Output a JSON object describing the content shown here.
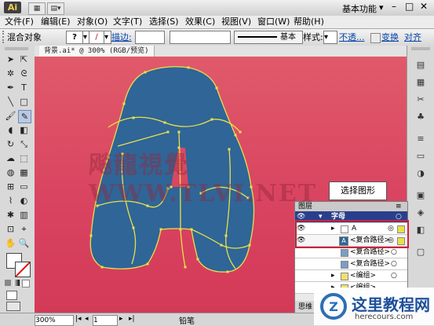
{
  "app": {
    "logo": "Ai",
    "workspace": "基本功能"
  },
  "menu": [
    "文件(F)",
    "编辑(E)",
    "对象(O)",
    "文字(T)",
    "选择(S)",
    "效果(C)",
    "视图(V)",
    "窗口(W)",
    "帮助(H)"
  ],
  "control": {
    "selection": "混合对象",
    "stroke_label": "描边:",
    "style_label": "样式:",
    "brush_value": "基本",
    "opacity_link": "不透...",
    "transform_link": "变换",
    "align_link": "对齐"
  },
  "document": {
    "tab": "背景.ai* @ 300% (RGB/预览)"
  },
  "canvas": {
    "watermark": "飚龍視覺WWW.TLVI.NET",
    "fill": "#2f6597",
    "bg": "#d94460",
    "path": "#e8e04a"
  },
  "layers": {
    "title": "图层",
    "rows": [
      {
        "name": "字母",
        "type": "layer"
      },
      {
        "name": "A",
        "type": "group"
      },
      {
        "name": "<复合路径>",
        "type": "item"
      },
      {
        "name": "<复合路径>",
        "type": "item"
      },
      {
        "name": "<复合路径>",
        "type": "item"
      },
      {
        "name": "<编组>",
        "type": "item"
      },
      {
        "name": "<编组>",
        "type": "item"
      }
    ],
    "footer": "思维"
  },
  "callout": "选择图形",
  "status": {
    "zoom": "300%",
    "page": "1",
    "tool": "铅笔"
  },
  "brand": {
    "title": "这里教程网",
    "url": "herecours.com"
  }
}
